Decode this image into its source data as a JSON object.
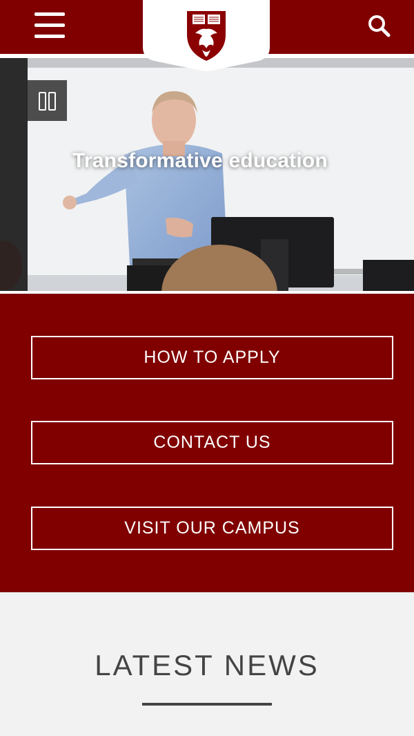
{
  "header": {
    "menu_icon": "hamburger-menu-icon",
    "search_icon": "search-icon",
    "logo": "university-shield-logo",
    "colors": {
      "brand": "#800000",
      "background": "#ffffff"
    }
  },
  "hero": {
    "caption": "Transformative education",
    "pause_icon": "pause-icon"
  },
  "cta": {
    "buttons": [
      {
        "label": "HOW TO APPLY"
      },
      {
        "label": "CONTACT US"
      },
      {
        "label": "VISIT OUR CAMPUS"
      }
    ]
  },
  "news": {
    "title": "LATEST NEWS"
  }
}
